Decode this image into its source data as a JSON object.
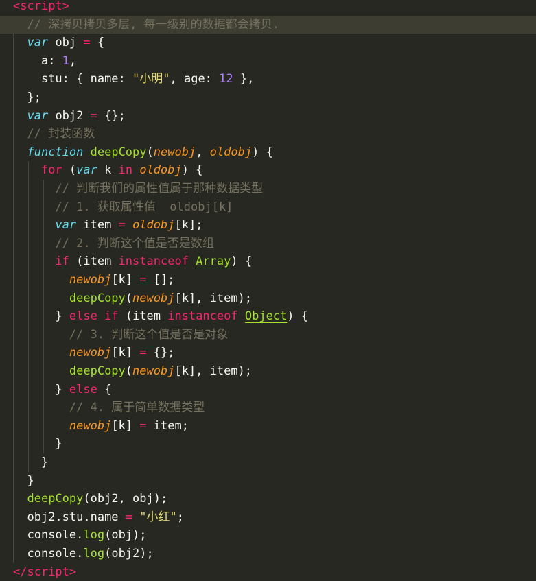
{
  "editor": {
    "theme_colors": {
      "background": "#272822",
      "current_line": "#3e3d32",
      "tag": "#f92672",
      "keyword": "#66d9ef",
      "operator_keyword": "#f92672",
      "function": "#a6e22e",
      "parameter": "#fd971f",
      "number": "#ae81ff",
      "string": "#e6db74",
      "comment": "#75715e",
      "text": "#f8f8f2"
    },
    "lines": [
      {
        "indent": "",
        "tokens": [
          [
            "tag",
            "<"
          ],
          [
            "tag",
            "script"
          ],
          [
            "tag",
            ">"
          ]
        ]
      },
      {
        "indent": "  ",
        "tokens": [
          [
            "cmt",
            "// 深拷贝拷贝多层, 每一级别的数据都会拷贝."
          ]
        ]
      },
      {
        "indent": "  ",
        "tokens": [
          [
            "kw",
            "var"
          ],
          [
            "plain",
            " obj "
          ],
          [
            "kw2",
            "="
          ],
          [
            "plain",
            " {"
          ]
        ]
      },
      {
        "indent": "    ",
        "tokens": [
          [
            "plain",
            "a: "
          ],
          [
            "num",
            "1"
          ],
          [
            "plain",
            ","
          ]
        ]
      },
      {
        "indent": "    ",
        "tokens": [
          [
            "plain",
            "stu: { name: "
          ],
          [
            "str",
            "\"小明\""
          ],
          [
            "plain",
            ", age: "
          ],
          [
            "num",
            "12"
          ],
          [
            "plain",
            " },"
          ]
        ]
      },
      {
        "indent": "  ",
        "tokens": [
          [
            "plain",
            "};"
          ]
        ]
      },
      {
        "indent": "  ",
        "tokens": [
          [
            "kw",
            "var"
          ],
          [
            "plain",
            " obj2 "
          ],
          [
            "kw2",
            "="
          ],
          [
            "plain",
            " {};"
          ]
        ]
      },
      {
        "indent": "  ",
        "tokens": [
          [
            "cmt",
            "// 封装函数"
          ]
        ]
      },
      {
        "indent": "  ",
        "tokens": [
          [
            "kw",
            "function"
          ],
          [
            "plain",
            " "
          ],
          [
            "fn",
            "deepCopy"
          ],
          [
            "plain",
            "("
          ],
          [
            "param",
            "newobj"
          ],
          [
            "plain",
            ", "
          ],
          [
            "param",
            "oldobj"
          ],
          [
            "plain",
            ") {"
          ]
        ]
      },
      {
        "indent": "    ",
        "tokens": [
          [
            "kw2",
            "for"
          ],
          [
            "plain",
            " ("
          ],
          [
            "kw",
            "var"
          ],
          [
            "plain",
            " k "
          ],
          [
            "kw2",
            "in"
          ],
          [
            "plain",
            " "
          ],
          [
            "param",
            "oldobj"
          ],
          [
            "plain",
            ") {"
          ]
        ]
      },
      {
        "indent": "      ",
        "tokens": [
          [
            "cmt",
            "// 判断我们的属性值属于那种数据类型"
          ]
        ]
      },
      {
        "indent": "      ",
        "tokens": [
          [
            "cmt",
            "// 1. 获取属性值  oldobj[k]"
          ]
        ]
      },
      {
        "indent": "      ",
        "tokens": [
          [
            "kw",
            "var"
          ],
          [
            "plain",
            " item "
          ],
          [
            "kw2",
            "="
          ],
          [
            "plain",
            " "
          ],
          [
            "param",
            "oldobj"
          ],
          [
            "plain",
            "[k];"
          ]
        ]
      },
      {
        "indent": "      ",
        "tokens": [
          [
            "cmt",
            "// 2. 判断这个值是否是数组"
          ]
        ]
      },
      {
        "indent": "      ",
        "tokens": [
          [
            "kw2",
            "if"
          ],
          [
            "plain",
            " (item "
          ],
          [
            "kw2",
            "instanceof"
          ],
          [
            "plain",
            " "
          ],
          [
            "cls",
            "Array"
          ],
          [
            "plain",
            ") {"
          ]
        ]
      },
      {
        "indent": "        ",
        "tokens": [
          [
            "param",
            "newobj"
          ],
          [
            "plain",
            "[k] "
          ],
          [
            "kw2",
            "="
          ],
          [
            "plain",
            " [];"
          ]
        ]
      },
      {
        "indent": "        ",
        "tokens": [
          [
            "fn",
            "deepCopy"
          ],
          [
            "plain",
            "("
          ],
          [
            "param",
            "newobj"
          ],
          [
            "plain",
            "[k], item);"
          ]
        ]
      },
      {
        "indent": "      ",
        "tokens": [
          [
            "plain",
            "} "
          ],
          [
            "kw2",
            "else"
          ],
          [
            "plain",
            " "
          ],
          [
            "kw2",
            "if"
          ],
          [
            "plain",
            " (item "
          ],
          [
            "kw2",
            "instanceof"
          ],
          [
            "plain",
            " "
          ],
          [
            "cls",
            "Object"
          ],
          [
            "plain",
            ") {"
          ]
        ]
      },
      {
        "indent": "        ",
        "tokens": [
          [
            "cmt",
            "// 3. 判断这个值是否是对象"
          ]
        ]
      },
      {
        "indent": "        ",
        "tokens": [
          [
            "param",
            "newobj"
          ],
          [
            "plain",
            "[k] "
          ],
          [
            "kw2",
            "="
          ],
          [
            "plain",
            " {};"
          ]
        ]
      },
      {
        "indent": "        ",
        "tokens": [
          [
            "fn",
            "deepCopy"
          ],
          [
            "plain",
            "("
          ],
          [
            "param",
            "newobj"
          ],
          [
            "plain",
            "[k], item);"
          ]
        ]
      },
      {
        "indent": "      ",
        "tokens": [
          [
            "plain",
            "} "
          ],
          [
            "kw2",
            "else"
          ],
          [
            "plain",
            " {"
          ]
        ]
      },
      {
        "indent": "        ",
        "tokens": [
          [
            "cmt",
            "// 4. 属于简单数据类型"
          ]
        ]
      },
      {
        "indent": "        ",
        "tokens": [
          [
            "param",
            "newobj"
          ],
          [
            "plain",
            "[k] "
          ],
          [
            "kw2",
            "="
          ],
          [
            "plain",
            " item;"
          ]
        ]
      },
      {
        "indent": "      ",
        "tokens": [
          [
            "plain",
            "}"
          ]
        ]
      },
      {
        "indent": "    ",
        "tokens": [
          [
            "plain",
            "}"
          ]
        ]
      },
      {
        "indent": "  ",
        "tokens": [
          [
            "plain",
            "}"
          ]
        ]
      },
      {
        "indent": "  ",
        "tokens": [
          [
            "fn",
            "deepCopy"
          ],
          [
            "plain",
            "(obj2, obj);"
          ]
        ]
      },
      {
        "indent": "  ",
        "tokens": [
          [
            "plain",
            "obj2.stu.name "
          ],
          [
            "kw2",
            "="
          ],
          [
            "plain",
            " "
          ],
          [
            "str",
            "\"小红\""
          ],
          [
            "plain",
            ";"
          ]
        ]
      },
      {
        "indent": "  ",
        "tokens": [
          [
            "plain",
            "console."
          ],
          [
            "fn",
            "log"
          ],
          [
            "plain",
            "(obj);"
          ]
        ]
      },
      {
        "indent": "  ",
        "tokens": [
          [
            "plain",
            "console."
          ],
          [
            "fn",
            "log"
          ],
          [
            "plain",
            "(obj2);"
          ]
        ]
      },
      {
        "indent": "",
        "tokens": [
          [
            "tag",
            "</"
          ],
          [
            "tag",
            "script"
          ],
          [
            "tag",
            ">"
          ]
        ]
      }
    ],
    "highlighted_line": 1
  }
}
